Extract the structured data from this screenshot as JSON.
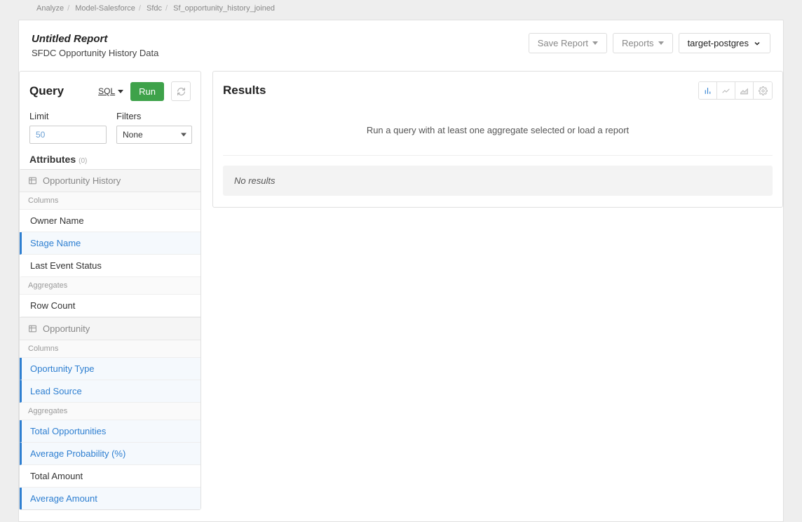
{
  "breadcrumb": [
    "Analyze",
    "Model-Salesforce",
    "Sfdc",
    "Sf_opportunity_history_joined"
  ],
  "header": {
    "title": "Untitled Report",
    "subtitle": "SFDC Opportunity History Data",
    "buttons": {
      "save": "Save Report",
      "reports": "Reports",
      "target": "target-postgres"
    }
  },
  "query": {
    "title": "Query",
    "sql_label": "SQL",
    "run_label": "Run",
    "limit": {
      "label": "Limit",
      "placeholder": "50"
    },
    "filters": {
      "label": "Filters",
      "value": "None"
    },
    "attributes_label": "Attributes",
    "attributes_count": "0",
    "groups": [
      {
        "name": "Opportunity History",
        "columns_label": "Columns",
        "columns": [
          {
            "label": "Owner Name",
            "selected": false
          },
          {
            "label": "Stage Name",
            "selected": true
          },
          {
            "label": "Last Event Status",
            "selected": false
          }
        ],
        "aggregates_label": "Aggregates",
        "aggregates": [
          {
            "label": "Row Count",
            "selected": false
          }
        ]
      },
      {
        "name": "Opportunity",
        "columns_label": "Columns",
        "columns": [
          {
            "label": "Oportunity Type",
            "selected": true
          },
          {
            "label": "Lead Source",
            "selected": true
          }
        ],
        "aggregates_label": "Aggregates",
        "aggregates": [
          {
            "label": "Total Opportunities",
            "selected": true
          },
          {
            "label": "Average Probability (%)",
            "selected": true
          },
          {
            "label": "Total Amount",
            "selected": false
          },
          {
            "label": "Average Amount",
            "selected": true
          }
        ]
      }
    ]
  },
  "results": {
    "title": "Results",
    "placeholder": "Run a query with at least one aggregate selected or load a report",
    "no_results": "No results"
  }
}
